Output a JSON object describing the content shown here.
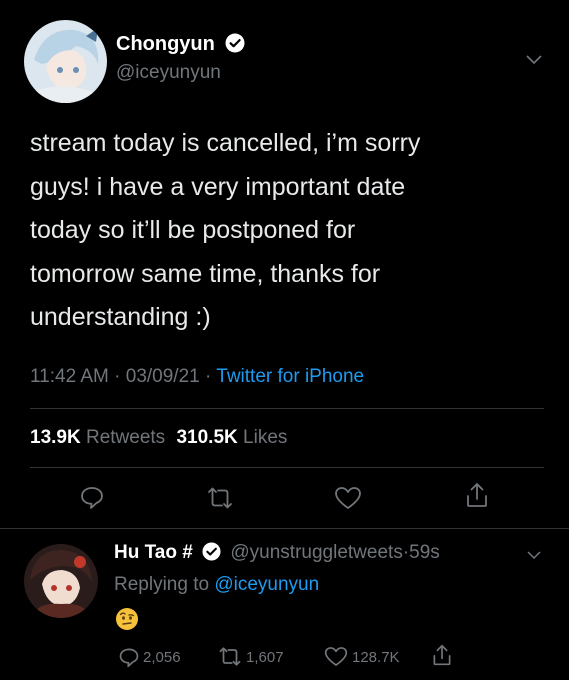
{
  "tweet": {
    "display_name": "Chongyun",
    "handle": "@iceyunyun",
    "text_lines": [
      "stream today is cancelled, i’m sorry",
      "guys! i have a very important date",
      "today so it’ll be postponed for",
      "tomorrow same time, thanks for",
      "understanding :)"
    ],
    "time": "11:42 AM",
    "date": "03/09/21",
    "separator": "·",
    "source": "Twitter for iPhone",
    "retweets_count": "13.9K",
    "retweets_label": "Retweets",
    "likes_count": "310.5K",
    "likes_label": "Likes"
  },
  "reply": {
    "display_name": "Hu Tao #",
    "handle": "@yunstruggletweets",
    "separator": "·",
    "time_ago": "59s",
    "replying_prefix": "Replying to",
    "replying_to": "@iceyunyun",
    "reply_count": "2,056",
    "retweet_count": "1,607",
    "like_count": "128.7K"
  },
  "icons": {
    "verified": "verified-badge-icon",
    "more": "chevron-down-icon",
    "reply": "comment-icon",
    "retweet": "retweet-icon",
    "like": "heart-icon",
    "share": "share-icon",
    "emoji": "raised-eyebrow-emoji"
  },
  "colors": {
    "background": "#000000",
    "text": "#e7e9ea",
    "muted": "#71767b",
    "accent": "#1d9bf0",
    "divider": "#2f3336"
  }
}
